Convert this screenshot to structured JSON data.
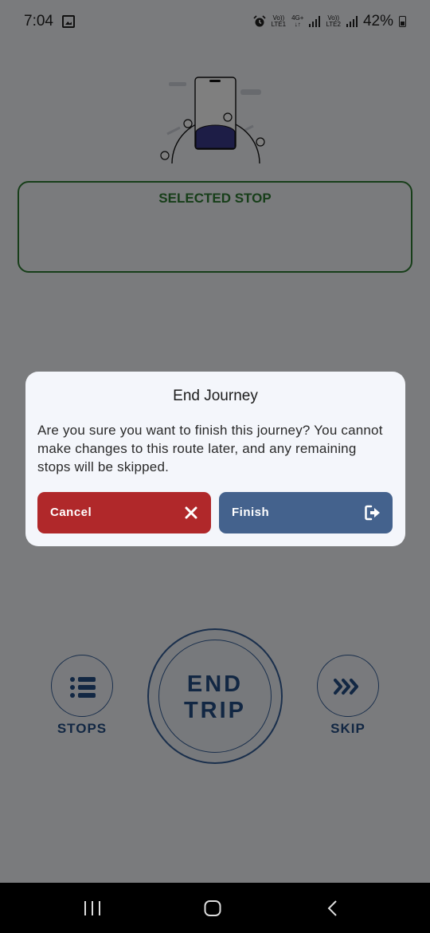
{
  "status_bar": {
    "time": "7:04",
    "sim1_label_top": "Vo))",
    "sim1_label_bottom": "LTE1",
    "net_top": "4G+",
    "net_bottom": "↓↑",
    "sim2_label_top": "Vo))",
    "sim2_label_bottom": "LTE2",
    "battery": "42%"
  },
  "selected_stop": {
    "label": "SELECTED STOP"
  },
  "controls": {
    "stops_label": "STOPS",
    "skip_label": "SKIP",
    "end_trip_line1": "END",
    "end_trip_line2": "TRIP"
  },
  "dialog": {
    "title": "End Journey",
    "message": "Are you sure you want to finish this journey? You cannot make changes to this route later, and any remaining stops will be skipped.",
    "cancel_label": "Cancel",
    "finish_label": "Finish"
  },
  "colors": {
    "cancel": "#b0282a",
    "finish": "#44628d",
    "accent_green": "#2e7d32",
    "accent_blue": "#244f86"
  }
}
